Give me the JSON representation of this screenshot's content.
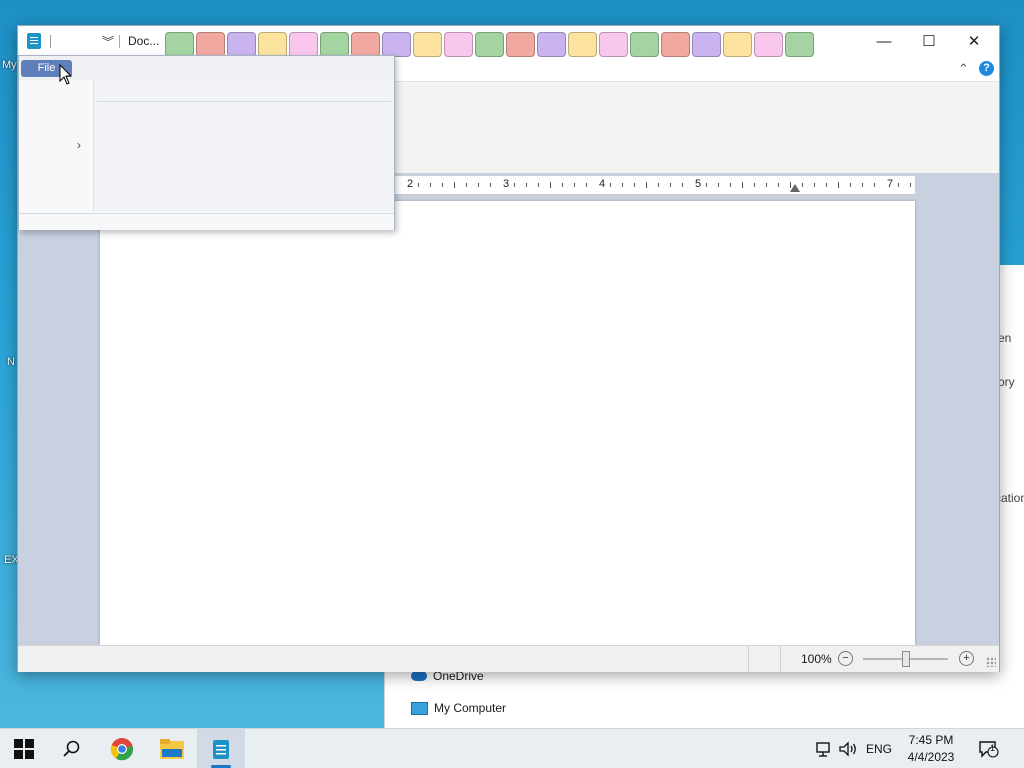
{
  "desktop": {
    "labels": [
      "My",
      "N",
      "EX"
    ]
  },
  "explorer": {
    "nav_items": [
      "OneDrive",
      "My Computer"
    ],
    "cut_texts": [
      "en",
      "ory",
      "cation"
    ]
  },
  "window": {
    "doc_title": "Doc...",
    "swatch_colors": [
      "#a4d4a2",
      "#f0a8a0",
      "#c9b4ef",
      "#fde3a0",
      "#f9c6ec",
      "#a4d4a2",
      "#f0a8a0",
      "#c9b4ef",
      "#fde3a0",
      "#f9c6ec",
      "#a4d4a2",
      "#f0a8a0",
      "#c9b4ef",
      "#fde3a0",
      "#f9c6ec",
      "#a4d4a2",
      "#f0a8a0",
      "#c9b4ef",
      "#fde3a0",
      "#f9c6ec",
      "#a4d4a2"
    ],
    "minimize_glyph": "—",
    "maximize_glyph": "☐",
    "close_glyph": "✕",
    "help_glyph": "?",
    "collapse_glyph": "⌃"
  },
  "ruler": {
    "labels": [
      "2",
      "3",
      "4",
      "5",
      "7"
    ]
  },
  "file_menu": {
    "tab_label": "File",
    "chevron": "›"
  },
  "statusbar": {
    "zoom": "100%",
    "zoom_out": "−",
    "zoom_in": "+"
  },
  "taskbar": {
    "tray_lang": "ENG",
    "time": "7:45 PM",
    "date": "4/4/2023",
    "notification_count": "1"
  }
}
